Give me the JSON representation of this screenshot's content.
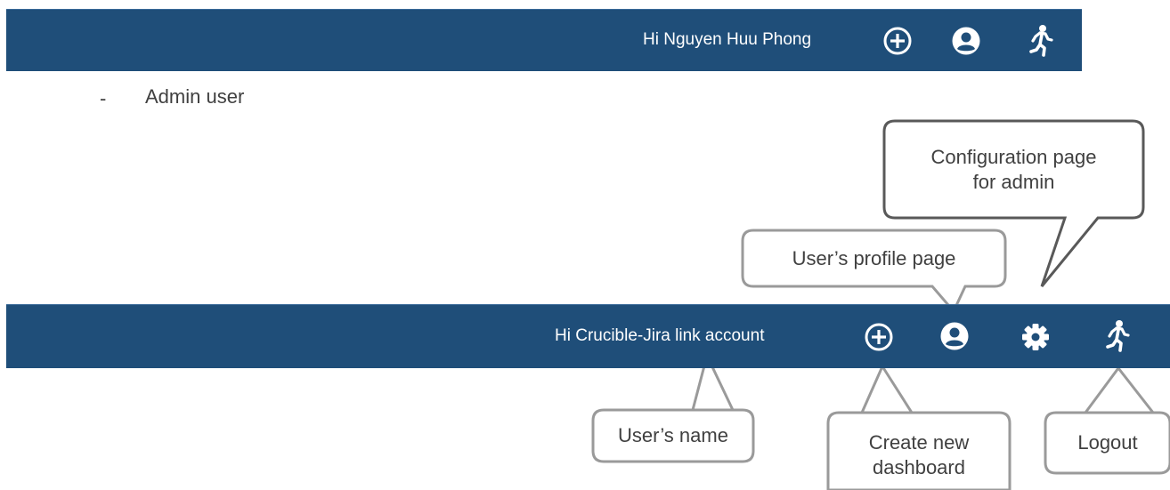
{
  "top_bar": {
    "greeting": "Hi Nguyen Huu Phong",
    "icons": [
      "plus-circle-icon",
      "user-circle-icon",
      "running-man-icon"
    ]
  },
  "bullet": {
    "dash": "-",
    "text": "Admin user"
  },
  "admin_bar": {
    "greeting": "Hi Crucible-Jira link account",
    "icons": [
      "plus-circle-icon",
      "user-circle-icon",
      "gear-icon",
      "running-man-icon"
    ]
  },
  "callouts": {
    "config_line1": "Configuration page",
    "config_line2": "for admin",
    "profile": "User’s profile page",
    "name": "User’s name",
    "create_line1": "Create new",
    "create_line2": "dashboard",
    "logout": "Logout"
  },
  "colors": {
    "bar": "#1f4e79",
    "callout_border_dark": "#595959",
    "callout_border_light": "#9a9a9a",
    "text": "#404040"
  }
}
